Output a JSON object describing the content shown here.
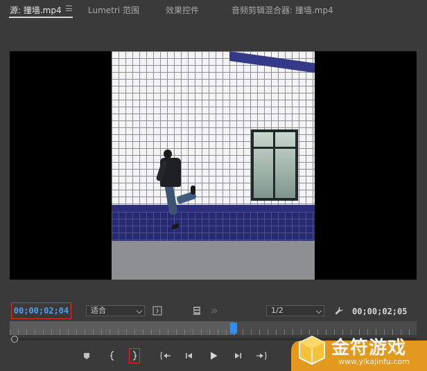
{
  "tabs": [
    {
      "label": "源: 撞墙.mp4",
      "active": true
    },
    {
      "label": "Lumetri 范围",
      "active": false
    },
    {
      "label": "效果控件",
      "active": false
    },
    {
      "label": "音频剪辑混合器: 撞墙.mp4",
      "active": false
    }
  ],
  "controls": {
    "current_timecode": "00;00;02;04",
    "fit_label": "适合",
    "resolution_label": "1/2",
    "duration_timecode": "00;00;02;05"
  },
  "timeline": {
    "playhead_fraction": 0.55
  },
  "transport": [
    {
      "name": "add-marker-button",
      "icon": "marker-icon"
    },
    {
      "name": "mark-in-button",
      "icon": "mark-in-icon"
    },
    {
      "name": "mark-out-button",
      "icon": "mark-out-icon",
      "highlighted": true
    },
    {
      "name": "go-to-in-button",
      "icon": "go-to-in-icon"
    },
    {
      "name": "step-back-button",
      "icon": "step-back-icon"
    },
    {
      "name": "play-button",
      "icon": "play-icon"
    },
    {
      "name": "step-forward-button",
      "icon": "step-forward-icon"
    },
    {
      "name": "go-to-out-button",
      "icon": "go-to-out-icon"
    }
  ],
  "watermark": {
    "brand": "金符游戏",
    "url": "www.yikajinfu.com"
  },
  "colors": {
    "accent_blue": "#2f8ff0",
    "timecode_blue": "#4e9ee8",
    "highlight_red": "#e0302a",
    "background": "#3a3a3a"
  }
}
